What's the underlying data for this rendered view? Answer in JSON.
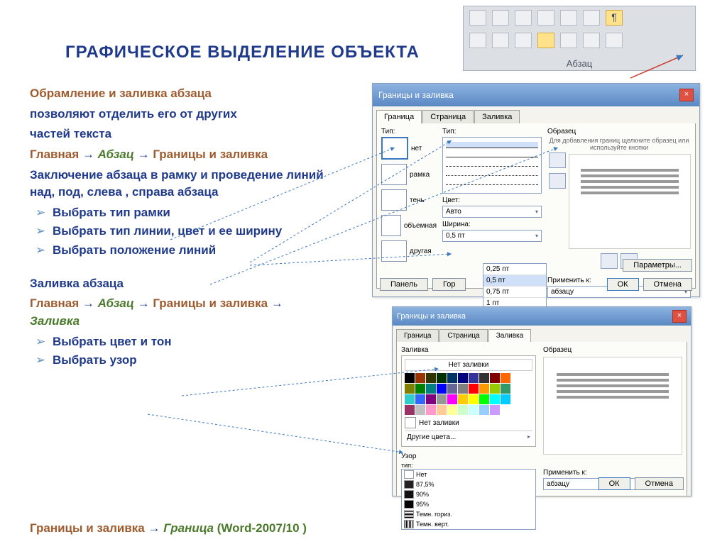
{
  "title": "ГРАФИЧЕСКОЕ ВЫДЕЛЕНИЕ ОБЪЕКТА",
  "text": {
    "intro1": "Обрамление и заливка абзаца",
    "intro2": "позволяют отделить его от других",
    "intro3": "частей текста",
    "path1a": "Главная",
    "arrow": " → ",
    "path1b": "Абзац",
    "path1c": "Границы и заливка",
    "frame": "Заключение абзаца в рамку и проведение линий над, под, слева , справа абзаца",
    "b1": "Выбрать тип рамки",
    "b2": "Выбрать тип линии, цвет и ее ширину",
    "b3": "Выбрать положение линий",
    "fill_h": "Заливка абзаца",
    "path2d": "Заливка",
    "b4": "Выбрать цвет и тон",
    "b5": "Выбрать узор",
    "footer1": "Границы и заливка",
    "footer2": "Граница",
    "footer3": "(Word-2007/10 )"
  },
  "ribbon": {
    "label": "Абзац",
    "pilcrow": "¶"
  },
  "dialog1": {
    "title": "Границы и заливка",
    "tabs": [
      "Граница",
      "Страница",
      "Заливка"
    ],
    "col1_label": "Тип:",
    "options": [
      "нет",
      "рамка",
      "тень",
      "объемная",
      "другая"
    ],
    "col2_type": "Тип:",
    "color_label": "Цвет:",
    "color_value": "Авто",
    "width_label": "Ширина:",
    "width_value": "0,5 пт",
    "width_options": [
      "0,25 пт",
      "0,5 пт",
      "0,75 пт",
      "1 пт"
    ],
    "sample_label": "Образец",
    "sample_hint": "Для добавления границ щелкните образец или используйте кнопки",
    "apply_label": "Применить к:",
    "apply_value": "абзацу",
    "params": "Параметры...",
    "panel": "Панель",
    "horiz": "Гор",
    "ok": "ОК",
    "cancel": "Отмена"
  },
  "dialog2": {
    "title": "Границы и заливка",
    "tabs": [
      "Граница",
      "Страница",
      "Заливка"
    ],
    "fill_label": "Заливка",
    "nofill": "Нет заливки",
    "nofill2": "Нет заливки",
    "other": "Другие цвета...",
    "pattern_label": "Узор",
    "type_label": "тип:",
    "patterns": [
      "Нет",
      "87,5%",
      "90%",
      "95%",
      "Темн. гориз.",
      "Темн. верт."
    ],
    "sample_label": "Образец",
    "apply_label": "Применить к:",
    "apply_value": "абзацу",
    "ok": "ОК",
    "cancel": "Отмена"
  }
}
